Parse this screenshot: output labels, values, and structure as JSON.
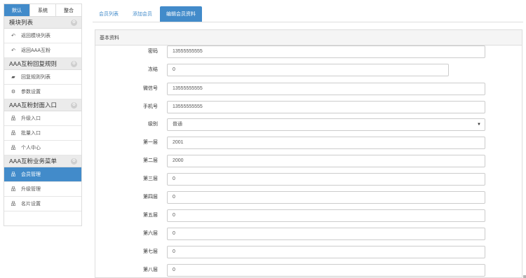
{
  "sidebar": {
    "top_tabs": [
      {
        "label": "默认",
        "active": true
      },
      {
        "label": "系统",
        "active": false
      },
      {
        "label": "整合",
        "active": false
      }
    ],
    "groups": [
      {
        "title": "模块列表",
        "items": [
          {
            "label": "返回模块列表",
            "icon": "reply-icon"
          },
          {
            "label": "返回AAA互粉",
            "icon": "reply-icon"
          }
        ]
      },
      {
        "title": "AAA互粉回复规则",
        "items": [
          {
            "label": "回复规则列表",
            "icon": "comments-icon"
          },
          {
            "label": "参数设置",
            "icon": "gear-icon"
          }
        ]
      },
      {
        "title": "AAA互粉封面入口",
        "items": [
          {
            "label": "升级入口",
            "icon": "sitemap-icon"
          },
          {
            "label": "批量入口",
            "icon": "sitemap-icon"
          },
          {
            "label": "个人中心",
            "icon": "sitemap-icon"
          }
        ]
      },
      {
        "title": "AAA互粉业务菜单",
        "items": [
          {
            "label": "会员管理",
            "icon": "sitemap-icon",
            "active": true
          },
          {
            "label": "升级管理",
            "icon": "sitemap-icon"
          },
          {
            "label": "名片设置",
            "icon": "sitemap-icon"
          }
        ]
      }
    ]
  },
  "main": {
    "tabs": [
      {
        "label": "会员列表",
        "active": false
      },
      {
        "label": "添加会员",
        "active": false
      },
      {
        "label": "编辑会员资料",
        "active": true
      }
    ],
    "panel_title": "基本资料",
    "fields": [
      {
        "label": "密码",
        "value": "13555555555",
        "type": "text"
      },
      {
        "label": "冻结",
        "value": "0",
        "type": "text-short"
      },
      {
        "label": "微信号",
        "value": "13555555555",
        "type": "text"
      },
      {
        "label": "手机号",
        "value": "13555555555",
        "type": "text"
      },
      {
        "label": "级别",
        "value": "普通",
        "type": "select"
      },
      {
        "label": "第一层",
        "value": "2001",
        "type": "text"
      },
      {
        "label": "第二层",
        "value": "2000",
        "type": "text"
      },
      {
        "label": "第三层",
        "value": "0",
        "type": "text"
      },
      {
        "label": "第四层",
        "value": "0",
        "type": "text"
      },
      {
        "label": "第五层",
        "value": "0",
        "type": "text"
      },
      {
        "label": "第六层",
        "value": "0",
        "type": "text"
      },
      {
        "label": "第七层",
        "value": "0",
        "type": "text"
      },
      {
        "label": "第八层",
        "value": "0",
        "type": "text"
      }
    ]
  },
  "colors": {
    "primary": "#428bca",
    "group_header_bg": "#ebebeb",
    "border": "#dddddd"
  }
}
